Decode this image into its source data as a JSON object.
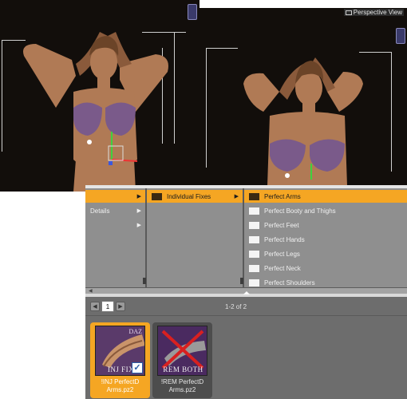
{
  "viewport": {
    "label": "Perspective View"
  },
  "browser": {
    "col1": {
      "items": [
        {
          "label": "",
          "selected": true,
          "has_arrow": true
        },
        {
          "label": "Details",
          "selected": false,
          "has_arrow": true
        },
        {
          "label": "",
          "selected": false,
          "has_arrow": true
        }
      ]
    },
    "col2": {
      "items": [
        {
          "label": "Individual Fixes",
          "selected": true,
          "has_arrow": true
        }
      ]
    },
    "col3": {
      "items": [
        {
          "label": "Perfect Arms",
          "selected": true
        },
        {
          "label": "Perfect Booty and Thighs",
          "selected": false
        },
        {
          "label": "Perfect Feet",
          "selected": false
        },
        {
          "label": "Perfect Hands",
          "selected": false
        },
        {
          "label": "Perfect Legs",
          "selected": false
        },
        {
          "label": "Perfect Neck",
          "selected": false
        },
        {
          "label": "Perfect Shoulders",
          "selected": false
        }
      ]
    }
  },
  "pager": {
    "prev_icon": "left-arrow-icon",
    "next_icon": "right-arrow-icon",
    "page": "1",
    "count": "1-2 of 2"
  },
  "tiles": [
    {
      "thumb_label": "INJ FIX",
      "brand": "DAZ",
      "name_line1": "!INJ PerfectD",
      "name_line2": "Arms.pz2",
      "selected": true,
      "checked": true
    },
    {
      "thumb_label": "REM BOTH",
      "brand": "",
      "name_line1": "!REM PerfectD",
      "name_line2": "Arms.pz2",
      "selected": false,
      "checked": false
    }
  ],
  "colors": {
    "selection": "#f5a623",
    "panel": "#6d6d6d",
    "column": "#8f8f8f",
    "viewport_bg": "#120e0b"
  }
}
